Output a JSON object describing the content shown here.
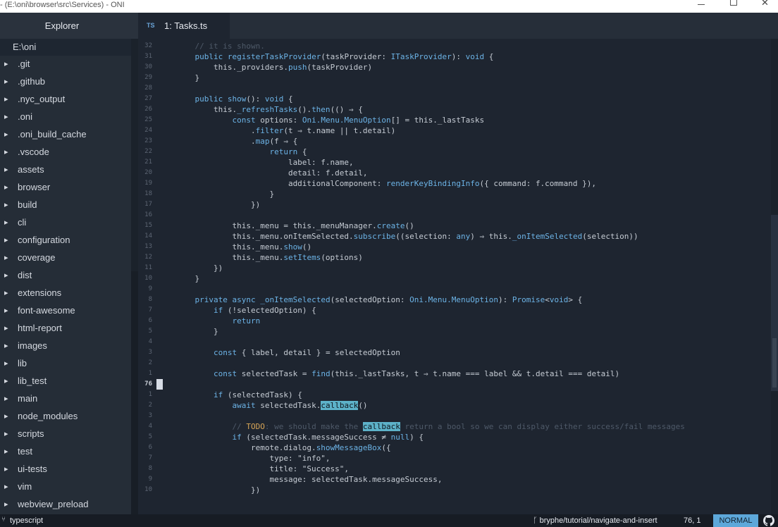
{
  "window": {
    "title": "- (E:\\oni\\browser\\src\\Services) - ONI",
    "controls": {
      "minimize": "minimize",
      "maximize": "maximize",
      "close": "✕"
    }
  },
  "sidebar": {
    "header": "Explorer",
    "root": "E:\\oni",
    "items": [
      {
        "label": ".git"
      },
      {
        "label": ".github"
      },
      {
        "label": ".nyc_output"
      },
      {
        "label": ".oni"
      },
      {
        "label": ".oni_build_cache"
      },
      {
        "label": ".vscode"
      },
      {
        "label": "assets"
      },
      {
        "label": "browser"
      },
      {
        "label": "build"
      },
      {
        "label": "cli"
      },
      {
        "label": "configuration"
      },
      {
        "label": "coverage"
      },
      {
        "label": "dist"
      },
      {
        "label": "extensions"
      },
      {
        "label": "font-awesome"
      },
      {
        "label": "html-report"
      },
      {
        "label": "images"
      },
      {
        "label": "lib"
      },
      {
        "label": "lib_test"
      },
      {
        "label": "main"
      },
      {
        "label": "node_modules"
      },
      {
        "label": "scripts"
      },
      {
        "label": "test"
      },
      {
        "label": "ui-tests"
      },
      {
        "label": "vim"
      },
      {
        "label": "webview_preload"
      }
    ]
  },
  "tabs": [
    {
      "badge": "TS",
      "label": "1: Tasks.ts"
    }
  ],
  "editor": {
    "lines": [
      {
        "n": "32",
        "code": "    // it is shown."
      },
      {
        "n": "31",
        "code": "    public registerTaskProvider(taskProvider: ITaskProvider): void {"
      },
      {
        "n": "30",
        "code": "        this._providers.push(taskProvider)"
      },
      {
        "n": "29",
        "code": "    }"
      },
      {
        "n": "28",
        "code": ""
      },
      {
        "n": "27",
        "code": "    public show(): void {"
      },
      {
        "n": "26",
        "code": "        this._refreshTasks().then(() ⇒ {"
      },
      {
        "n": "25",
        "code": "            const options: Oni.Menu.MenuOption[] = this._lastTasks"
      },
      {
        "n": "24",
        "code": "                .filter(t ⇒ t.name || t.detail)"
      },
      {
        "n": "23",
        "code": "                .map(f ⇒ {"
      },
      {
        "n": "22",
        "code": "                    return {"
      },
      {
        "n": "21",
        "code": "                        label: f.name,"
      },
      {
        "n": "20",
        "code": "                        detail: f.detail,"
      },
      {
        "n": "19",
        "code": "                        additionalComponent: renderKeyBindingInfo({ command: f.command }),"
      },
      {
        "n": "18",
        "code": "                    }"
      },
      {
        "n": "17",
        "code": "                })"
      },
      {
        "n": "16",
        "code": ""
      },
      {
        "n": "15",
        "code": "            this._menu = this._menuManager.create()"
      },
      {
        "n": "14",
        "code": "            this._menu.onItemSelected.subscribe((selection: any) ⇒ this._onItemSelected(selection))"
      },
      {
        "n": "13",
        "code": "            this._menu.show()"
      },
      {
        "n": "12",
        "code": "            this._menu.setItems(options)"
      },
      {
        "n": "11",
        "code": "        })"
      },
      {
        "n": "10",
        "code": "    }"
      },
      {
        "n": "9",
        "code": ""
      },
      {
        "n": "8",
        "code": "    private async _onItemSelected(selectedOption: Oni.Menu.MenuOption): Promise<void> {"
      },
      {
        "n": "7",
        "code": "        if (!selectedOption) {"
      },
      {
        "n": "6",
        "code": "            return"
      },
      {
        "n": "5",
        "code": "        }"
      },
      {
        "n": "4",
        "code": ""
      },
      {
        "n": "3",
        "code": "        const { label, detail } = selectedOption"
      },
      {
        "n": "2",
        "code": ""
      },
      {
        "n": "1",
        "code": "        const selectedTask = find(this._lastTasks, t ⇒ t.name === label && t.detail === detail)"
      },
      {
        "n": "76",
        "code": "",
        "current": true
      },
      {
        "n": "1",
        "code": "        if (selectedTask) {"
      },
      {
        "n": "2",
        "code": "            await selectedTask.callback()"
      },
      {
        "n": "3",
        "code": ""
      },
      {
        "n": "4",
        "code": "            // TODO: we should make the callback return a bool so we can display either success/fail messages"
      },
      {
        "n": "5",
        "code": "            if (selectedTask.messageSuccess ≠ null) {"
      },
      {
        "n": "6",
        "code": "                remote.dialog.showMessageBox({"
      },
      {
        "n": "7",
        "code": "                    type: \"info\","
      },
      {
        "n": "8",
        "code": "                    title: \"Success\","
      },
      {
        "n": "9",
        "code": "                    message: selectedTask.messageSuccess,"
      },
      {
        "n": "10",
        "code": "                })"
      }
    ]
  },
  "statusbar": {
    "language": "typescript",
    "branch": "bryphe/tutorial/navigate-and-insert",
    "position": "76, 1",
    "mode": "NORMAL"
  },
  "colors": {
    "accent": "#5da8da",
    "background": "#1e2530",
    "sidebar": "#252d37",
    "highlight": "#5db2c9"
  },
  "icons": {
    "language": "branch-fork-icon",
    "branch": "git-branch-icon",
    "github": "github-icon"
  }
}
